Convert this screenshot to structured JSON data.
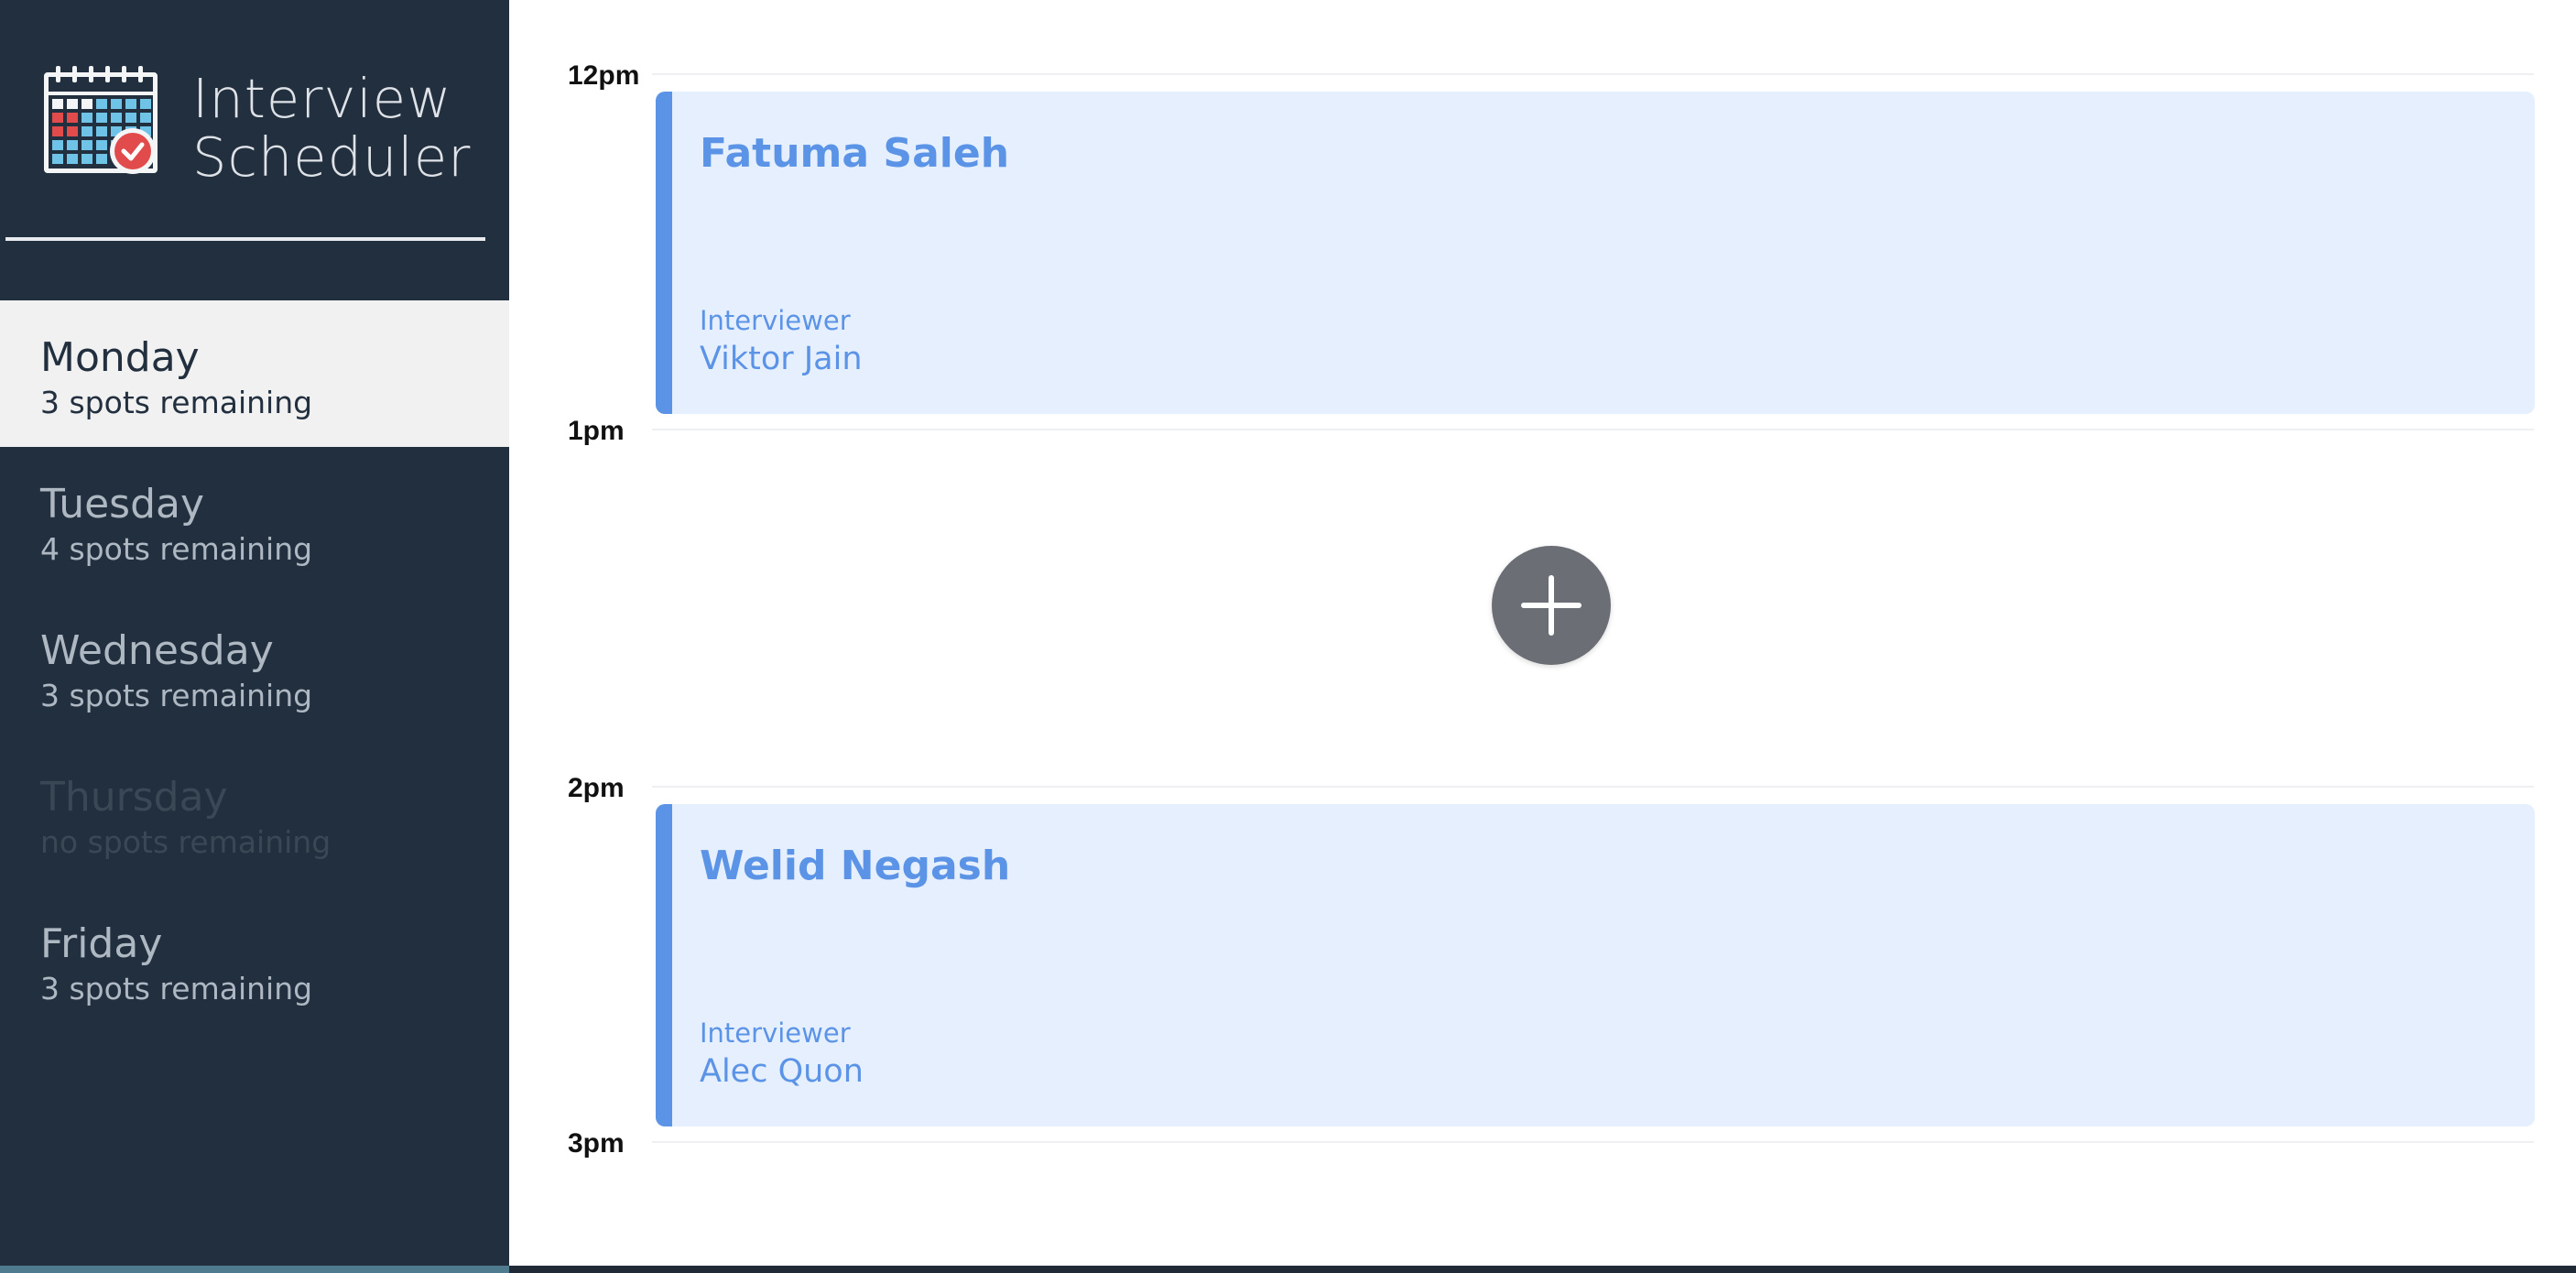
{
  "brand": {
    "line1": "Interview",
    "line2": "Scheduler",
    "logo_icon": "calendar-check-icon"
  },
  "days": [
    {
      "name": "Monday",
      "spots": "3 spots remaining",
      "state": "selected"
    },
    {
      "name": "Tuesday",
      "spots": "4 spots remaining",
      "state": "normal"
    },
    {
      "name": "Wednesday",
      "spots": "3 spots remaining",
      "state": "normal"
    },
    {
      "name": "Thursday",
      "spots": "no spots remaining",
      "state": "full"
    },
    {
      "name": "Friday",
      "spots": "3 spots remaining",
      "state": "normal"
    }
  ],
  "slots": [
    {
      "time": "12pm",
      "appointment": {
        "student": "Fatuma Saleh",
        "label": "Interviewer",
        "interviewer": "Viktor Jain"
      }
    },
    {
      "time": "1pm",
      "appointment": null,
      "add_icon": "plus-icon"
    },
    {
      "time": "2pm",
      "appointment": {
        "student": "Welid Negash",
        "label": "Interviewer",
        "interviewer": "Alec Quon"
      }
    },
    {
      "time": "3pm",
      "appointment": null
    }
  ],
  "colors": {
    "sidebar_bg": "#222f3e",
    "selected_bg": "#f1f1f1",
    "appointment_bg": "#e6effd",
    "appointment_accent": "#5b94e6",
    "add_button": "#6b6f75"
  }
}
